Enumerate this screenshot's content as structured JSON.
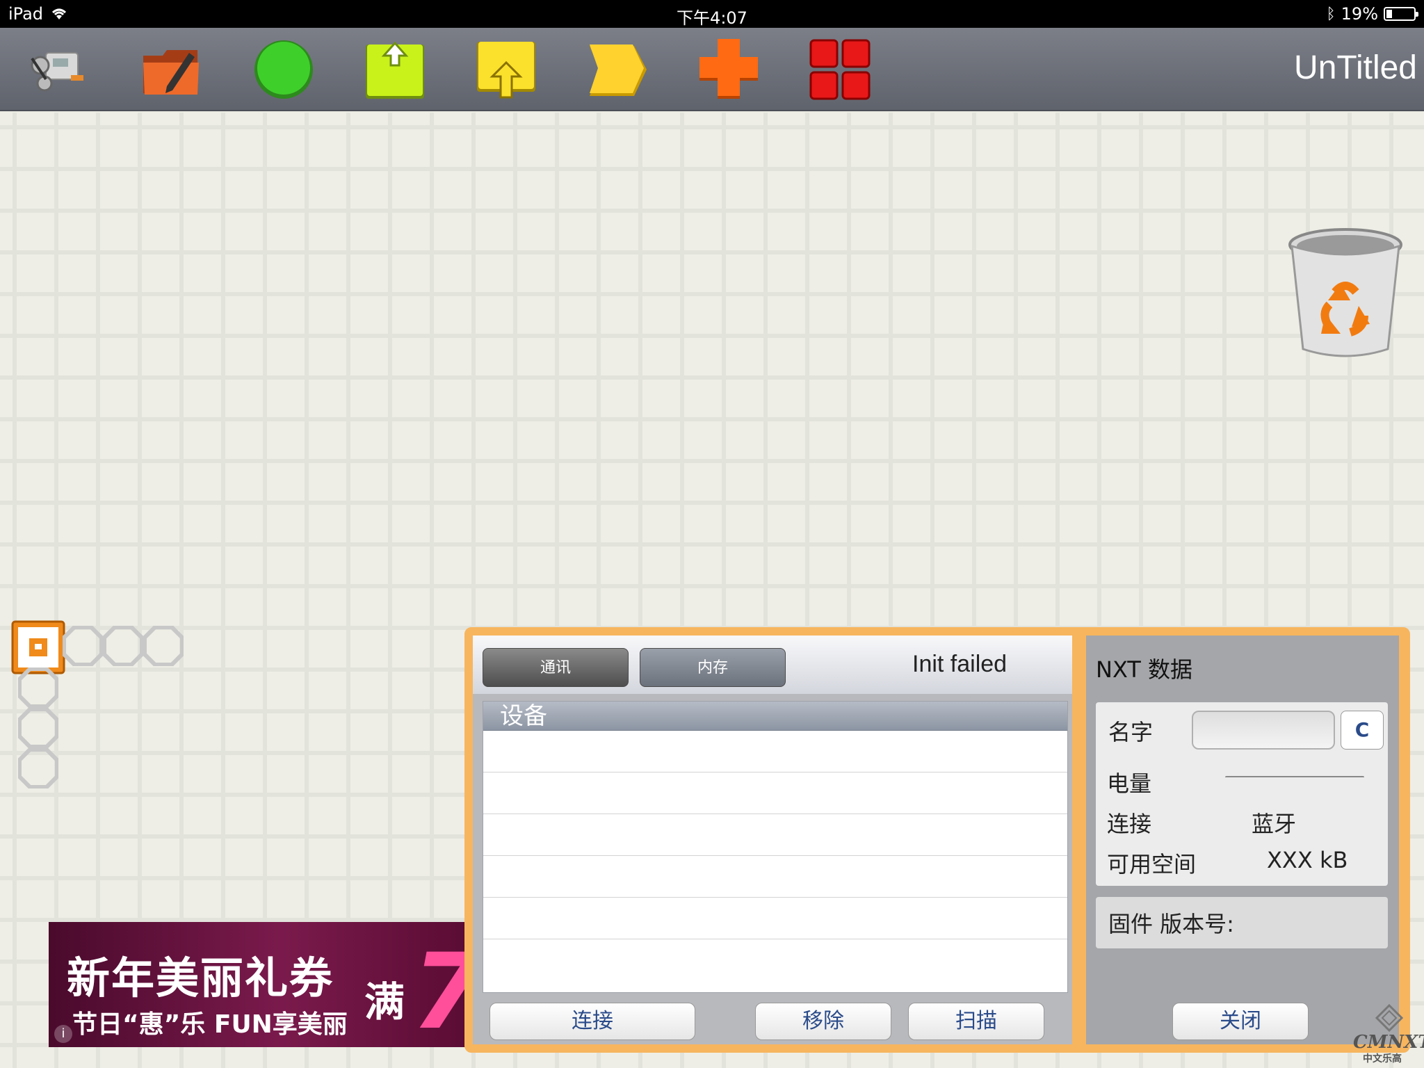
{
  "status_bar": {
    "device": "iPad",
    "time": "下午4:07",
    "battery_percent": "19%",
    "battery_level": 0.19
  },
  "toolbar": {
    "title": "UnTitled",
    "tools": [
      {
        "icon": "nxt-robot-icon"
      },
      {
        "icon": "folder-edit-icon"
      },
      {
        "icon": "green-circle-icon"
      },
      {
        "icon": "green-export-icon"
      },
      {
        "icon": "yellow-import-icon"
      },
      {
        "icon": "yellow-arrow-block-icon"
      },
      {
        "icon": "orange-cross-icon"
      },
      {
        "icon": "red-grid-icon"
      }
    ]
  },
  "canvas": {
    "trash_icon": "recycle-trash-icon",
    "start_block_icon": "start-block-icon"
  },
  "ad": {
    "headline": "新年美丽礼券",
    "subline": "节日“惠”乐 FUN享美丽",
    "man": "满",
    "big_number": "7",
    "info": "i"
  },
  "panel": {
    "tabs": [
      {
        "label": "通讯",
        "active": true
      },
      {
        "label": "内存",
        "active": false
      }
    ],
    "status": "Init failed",
    "list_header": "设备",
    "buttons": {
      "connect": "连接",
      "remove": "移除",
      "scan": "扫描"
    }
  },
  "nxt": {
    "title": "NXT 数据",
    "name_label": "名字",
    "name_value": "",
    "clear_button": "C",
    "power_label": "电量",
    "connection_label": "连接",
    "connection_value": "蓝牙",
    "space_label": "可用空间",
    "space_value": "XXX kB",
    "firmware_label": "固件 版本号:",
    "close_button": "关闭"
  },
  "watermark": {
    "brand": "CMNXT",
    "sub": "中文乐高"
  },
  "colors": {
    "toolbar": "#6e717a",
    "panel_border": "#f7b55e",
    "button_text": "#2a4b8a"
  }
}
